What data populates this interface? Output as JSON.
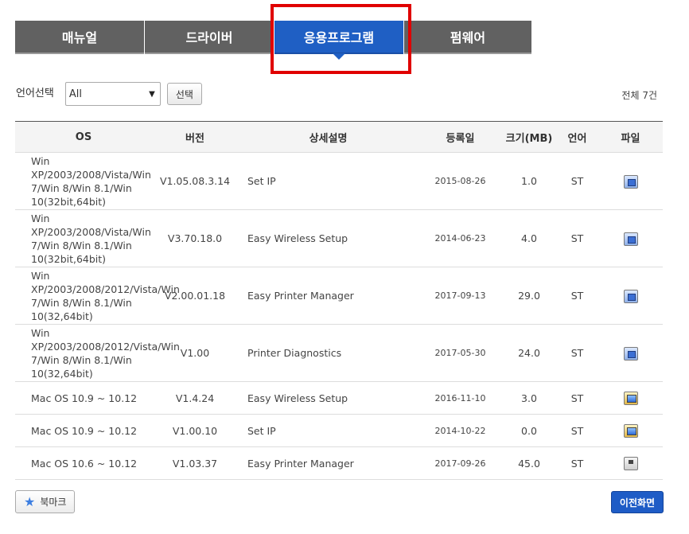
{
  "tabs": [
    {
      "label": "매뉴얼"
    },
    {
      "label": "드라이버"
    },
    {
      "label": "응용프로그램"
    },
    {
      "label": "펌웨어"
    }
  ],
  "filter": {
    "label": "언어선택",
    "selected": "All",
    "button": "선택"
  },
  "total": "전체 7건",
  "table": {
    "headers": {
      "os": "OS",
      "version": "버전",
      "desc": "상세설명",
      "date": "등록일",
      "size": "크기(MB)",
      "lang": "언어",
      "file": "파일"
    },
    "rows": [
      {
        "os": "Win XP/2003/2008/Vista/Win 7/Win 8/Win 8.1/Win 10(32bit,64bit)",
        "version": "V1.05.08.3.14",
        "desc": "Set IP",
        "date": "2015-08-26",
        "size": "1.0",
        "lang": "ST",
        "icon": "windows-download-icon"
      },
      {
        "os": "Win XP/2003/2008/Vista/Win 7/Win 8/Win 8.1/Win 10(32bit,64bit)",
        "version": "V3.70.18.0",
        "desc": "Easy Wireless Setup",
        "date": "2014-06-23",
        "size": "4.0",
        "lang": "ST",
        "icon": "windows-download-icon"
      },
      {
        "os": "Win XP/2003/2008/2012/Vista/Win 7/Win 8/Win 8.1/Win 10(32,64bit)",
        "version": "V2.00.01.18",
        "desc": "Easy Printer Manager",
        "date": "2017-09-13",
        "size": "29.0",
        "lang": "ST",
        "icon": "windows-download-icon"
      },
      {
        "os": "Win XP/2003/2008/2012/Vista/Win 7/Win 8/Win 8.1/Win 10(32,64bit)",
        "version": "V1.00",
        "desc": "Printer Diagnostics",
        "date": "2017-05-30",
        "size": "24.0",
        "lang": "ST",
        "icon": "windows-download-icon"
      },
      {
        "os": "Mac OS 10.9 ~ 10.12",
        "version": "V1.4.24",
        "desc": "Easy Wireless Setup",
        "date": "2016-11-10",
        "size": "3.0",
        "lang": "ST",
        "icon": "mac-download-icon"
      },
      {
        "os": "Mac OS 10.9 ~ 10.12",
        "version": "V1.00.10",
        "desc": "Set IP",
        "date": "2014-10-22",
        "size": "0.0",
        "lang": "ST",
        "icon": "mac-download-icon"
      },
      {
        "os": "Mac OS 10.6 ~ 10.12",
        "version": "V1.03.37",
        "desc": "Easy Printer Manager",
        "date": "2017-09-26",
        "size": "45.0",
        "lang": "ST",
        "icon": "disk-download-icon"
      }
    ]
  },
  "footer": {
    "bookmark": "북마크",
    "prev": "이전화면"
  },
  "colors": {
    "tab_bg": "#616161",
    "tab_active": "#1f5fc4",
    "highlight": "#e00000",
    "prev_button": "#1e5cc6"
  }
}
